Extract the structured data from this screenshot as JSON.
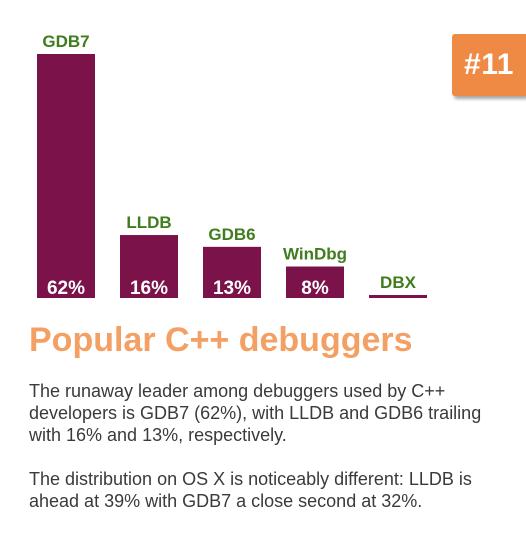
{
  "badge": {
    "text": "#11",
    "color": "#ef8a45"
  },
  "heading": {
    "text": "Popular C++ debuggers",
    "color": "#f4a064"
  },
  "paragraphs": [
    "The runaway leader among debuggers used by C++ developers is GDB7 (62%), with LLDB and GDB6 trailing with 16% and 13%, respectively.",
    "The distribution on OS X is noticeably different: LLDB is ahead at 39% with GDB7 a close second at 32%."
  ],
  "colors": {
    "bar": "#7b1249",
    "label": "#3f7d1e",
    "value_text": "#ffffff"
  },
  "chart_data": {
    "type": "bar",
    "title": "",
    "xlabel": "",
    "ylabel": "",
    "categories": [
      "GDB7",
      "LLDB",
      "GDB6",
      "WinDbg",
      "DBX"
    ],
    "values": [
      62,
      16,
      13,
      8,
      0.5
    ],
    "data_labels": [
      "62%",
      "16%",
      "13%",
      "8%",
      ""
    ],
    "ylim": [
      0,
      62
    ],
    "grid": false,
    "legend": "none"
  }
}
